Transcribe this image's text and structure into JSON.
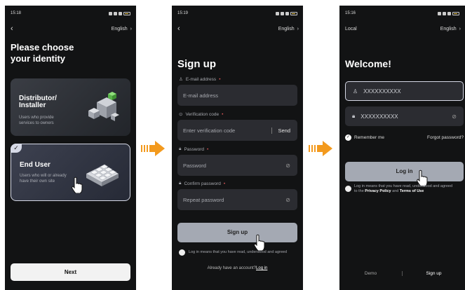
{
  "screen1": {
    "time": "15:18",
    "language": "English",
    "title_line1": "Please choose",
    "title_line2": "your identity",
    "card1_title_line1": "Distributor/",
    "card1_title_line2": "Installer",
    "card1_desc_line1": "Users who provide",
    "card1_desc_line2": "services to owners",
    "card2_title": "End User",
    "card2_desc_line1": "Users who will or already",
    "card2_desc_line2": "have their own site",
    "next_label": "Next"
  },
  "screen2": {
    "time": "15:19",
    "language": "English",
    "title": "Sign up",
    "email_label": "E-mail address",
    "email_placeholder": "E-mail address",
    "code_label": "Verification code",
    "code_placeholder": "Enter verification code",
    "send_label": "Send",
    "password_label": "Password",
    "password_placeholder": "Password",
    "confirm_label": "Confirm password",
    "confirm_placeholder": "Repeat password",
    "signup_label": "Sign up",
    "terms_text": "Log in means that you have read, understood and agreed",
    "account_text": "Already have an account?",
    "login_link": "Log in"
  },
  "screen3": {
    "time": "15:16",
    "region": "Local",
    "language": "English",
    "title": "Welcome!",
    "account_value": "XXXXXXXXXX",
    "password_value": "XXXXXXXXXX",
    "remember_label": "Remember me",
    "forgot_label": "Forgot password?",
    "login_label": "Log in",
    "terms_line1": "Log in means that you have read, understood and agreed",
    "terms_prefix": "to the",
    "privacy_label": "Privacy Policy",
    "and_label": "and",
    "terms_label": "Terms of Use",
    "demo_label": "Demo",
    "signup_label": "Sign up"
  },
  "colors": {
    "background": "#121314",
    "input": "#2b2c31",
    "button_disabled": "#a4a9b3",
    "arrow": "#f39a1e",
    "required": "#e35a5a"
  },
  "icons": [
    "back-arrow-icon",
    "chevron-right-icon",
    "user-icon",
    "lock-icon",
    "eye-off-icon",
    "shield-icon",
    "check-icon",
    "hand-pointer-icon",
    "arrow-right-icon"
  ]
}
